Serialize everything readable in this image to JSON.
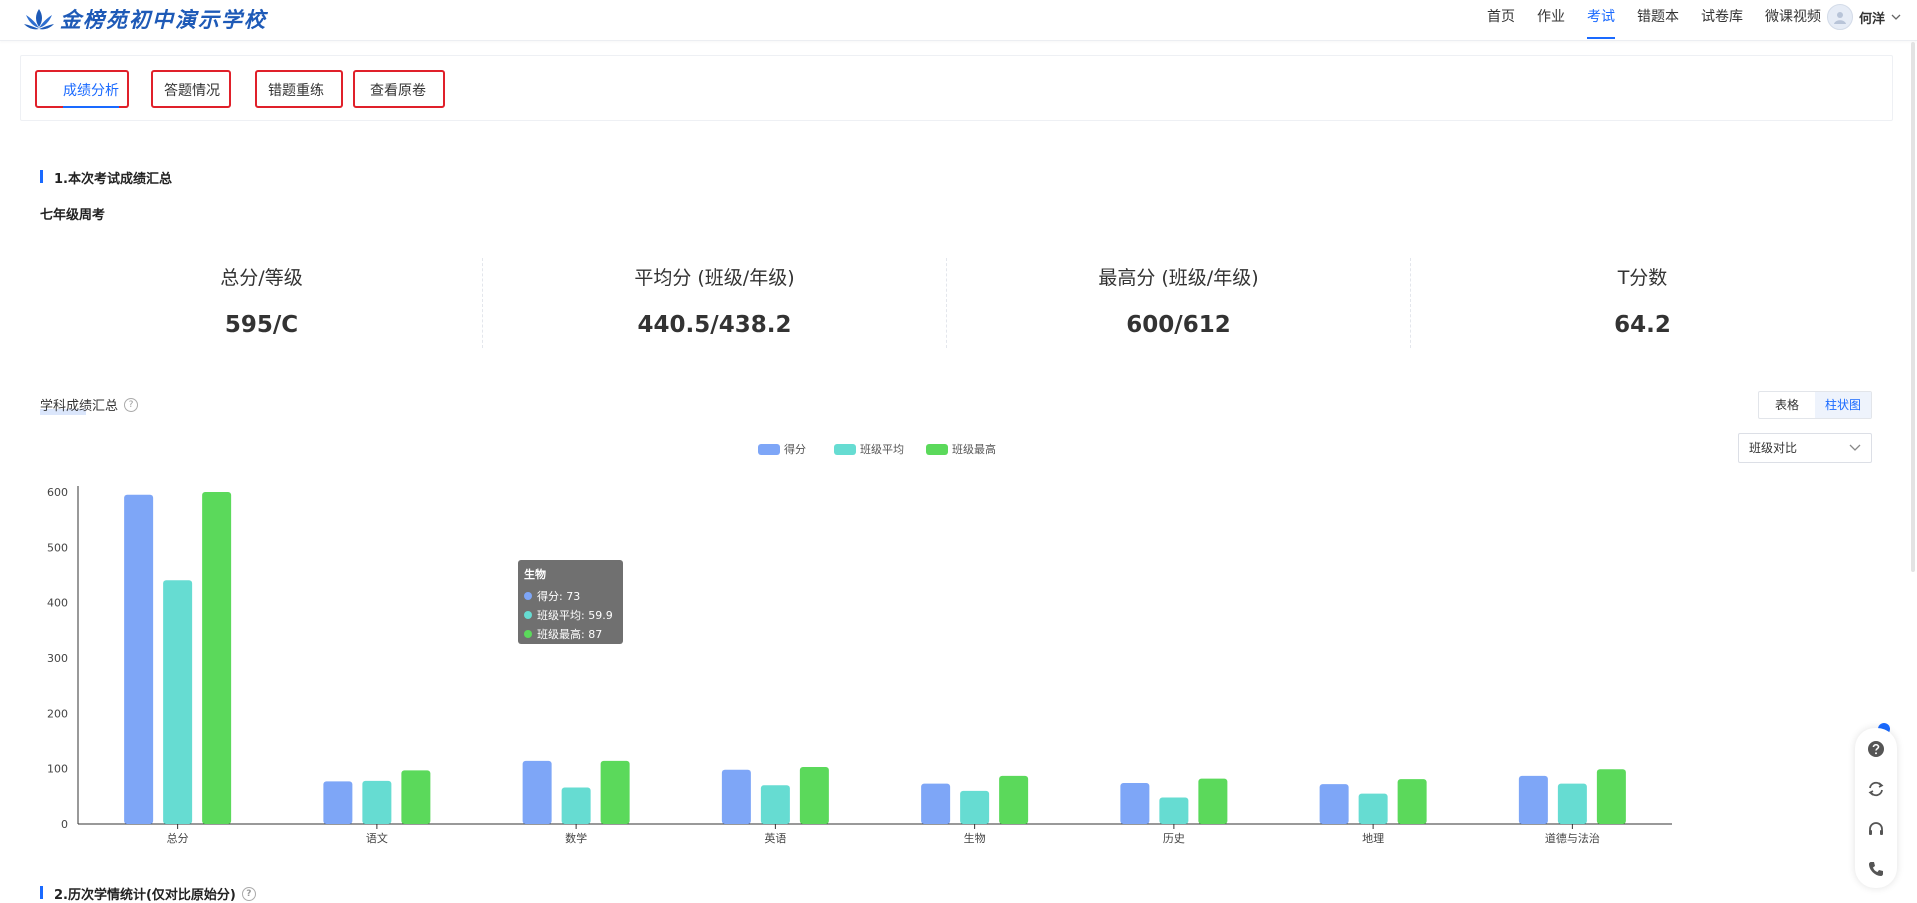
{
  "header": {
    "logo_text": "金榜苑初中演示学校",
    "nav": [
      "首页",
      "作业",
      "考试",
      "错题本",
      "试卷库",
      "微课视频"
    ],
    "active_nav_index": 2,
    "user_name": "何洋"
  },
  "tabs": [
    {
      "label": "成绩分析",
      "active": true
    },
    {
      "label": "答题情况",
      "active": false
    },
    {
      "label": "错题重练",
      "active": false
    },
    {
      "label": "查看原卷",
      "active": false
    }
  ],
  "section1": {
    "title": "1.本次考试成绩汇总",
    "exam_name": "七年级周考",
    "stats": [
      {
        "label": "总分/等级",
        "value": "595/C"
      },
      {
        "label": "平均分 (班级/年级)",
        "value": "440.5/438.2"
      },
      {
        "label": "最高分 (班级/年级)",
        "value": "600/612"
      },
      {
        "label": "T分数",
        "value": "64.2"
      }
    ]
  },
  "subject_summary": {
    "title": "学科成绩汇总",
    "help": "?",
    "view_options": [
      "表格",
      "柱状图"
    ],
    "active_view_index": 1,
    "compare_select": "班级对比"
  },
  "colors": {
    "accent": "#1a6aff",
    "score": "#7ea6f7",
    "class_avg": "#66dcd2",
    "class_max": "#5bd95b"
  },
  "chart_data": {
    "type": "bar",
    "categories": [
      "总分",
      "语文",
      "数学",
      "英语",
      "生物",
      "历史",
      "地理",
      "道德与法治"
    ],
    "series": [
      {
        "name": "得分",
        "values": [
          595,
          77,
          114,
          98,
          73,
          74,
          72,
          87
        ]
      },
      {
        "name": "班级平均",
        "values": [
          440.5,
          78,
          66,
          70,
          59.9,
          48,
          55,
          73
        ]
      },
      {
        "name": "班级最高",
        "values": [
          600,
          97,
          114,
          103,
          87,
          82,
          81,
          99
        ]
      }
    ],
    "yticks": [
      0,
      100,
      200,
      300,
      400,
      500,
      600
    ],
    "ylim": [
      0,
      600
    ],
    "legend_position": "top-center",
    "grid": false,
    "tooltip": {
      "title": "生物",
      "rows": [
        "得分: 73",
        "班级平均: 59.9",
        "班级最高: 87"
      ]
    }
  },
  "section2": {
    "title": "2.历次学情统计(仅对比原始分)",
    "help": "?"
  }
}
